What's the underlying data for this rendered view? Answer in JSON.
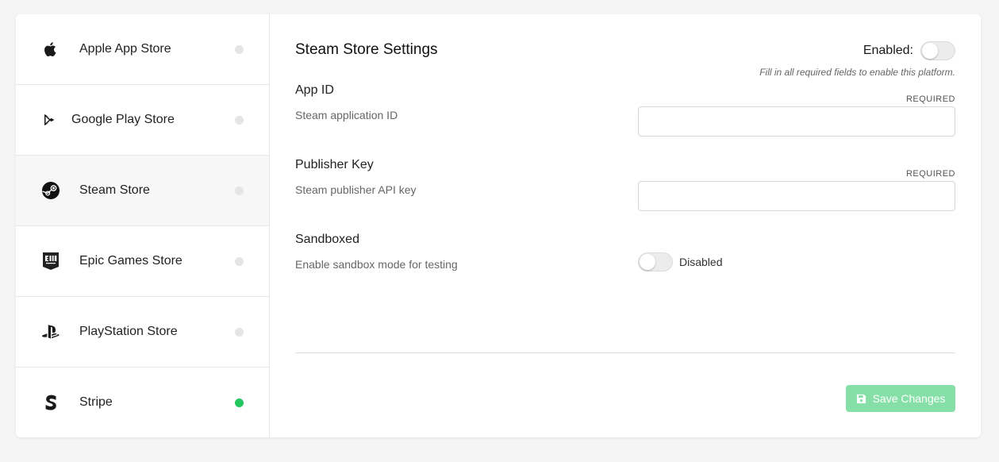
{
  "sidebar": {
    "items": [
      {
        "label": "Apple App Store",
        "icon": "apple-icon",
        "status": "off"
      },
      {
        "label": "Google Play Store",
        "icon": "google-play-icon",
        "status": "off"
      },
      {
        "label": "Steam Store",
        "icon": "steam-icon",
        "status": "off",
        "active": true
      },
      {
        "label": "Epic Games Store",
        "icon": "epic-games-icon",
        "status": "off"
      },
      {
        "label": "PlayStation Store",
        "icon": "playstation-icon",
        "status": "off"
      },
      {
        "label": "Stripe",
        "icon": "stripe-icon",
        "status": "on"
      }
    ]
  },
  "main": {
    "title": "Steam Store Settings",
    "enabled_label": "Enabled:",
    "enabled": false,
    "hint": "Fill in all required fields to enable this platform.",
    "fields": {
      "app_id": {
        "label": "App ID",
        "description": "Steam application ID",
        "required": "REQUIRED",
        "value": ""
      },
      "publisher_key": {
        "label": "Publisher Key",
        "description": "Steam publisher API key",
        "required": "REQUIRED",
        "value": ""
      },
      "sandboxed": {
        "label": "Sandboxed",
        "description": "Enable sandbox mode for testing",
        "state": "Disabled"
      }
    },
    "save_label": "Save Changes"
  },
  "colors": {
    "status_on": "#22c55e",
    "status_off": "#e5e5e5",
    "save_button": "#86dfa7"
  }
}
